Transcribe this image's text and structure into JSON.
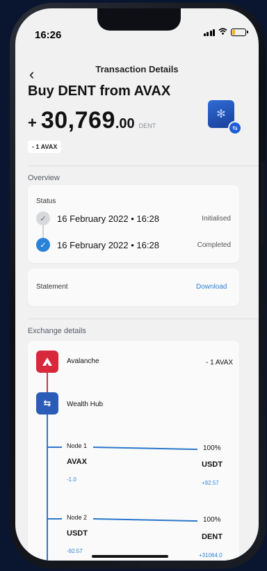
{
  "status_bar": {
    "time": "16:26"
  },
  "nav": {
    "back": "‹",
    "title": "Transaction Details"
  },
  "header": {
    "title": "Buy DENT from AVAX",
    "amount_sign": "+",
    "amount_integer": "30,769",
    "amount_decimal": ".00",
    "amount_currency": "DENT",
    "spent_pill": "- 1 AVAX"
  },
  "overview": {
    "section_label": "Overview",
    "status_label": "Status",
    "rows": [
      {
        "date": "16 February 2022 • 16:28",
        "state": "Initialised"
      },
      {
        "date": "16 February 2022 • 16:28",
        "state": "Completed"
      }
    ]
  },
  "statement": {
    "label": "Statement",
    "action": "Download"
  },
  "exchange": {
    "section_label": "Exchange details",
    "source": {
      "name": "Avalanche",
      "amount": "- 1 AVAX"
    },
    "hub": {
      "name": "Wealth Hub"
    },
    "nodes": [
      {
        "label": "Node 1",
        "percent": "100%",
        "from": "AVAX",
        "to": "USDT",
        "from_delta": "-1.0",
        "to_delta": "+92.57"
      },
      {
        "label": "Node 2",
        "percent": "100%",
        "from": "USDT",
        "to": "DENT",
        "from_delta": "-92.57",
        "to_delta": "+31064.0"
      }
    ]
  },
  "colors": {
    "accent": "#2a82d7",
    "avalanche_red": "#d8283c",
    "hub_blue": "#2b5db8",
    "tree_line": "#2a77cc"
  },
  "icons": {
    "status_pending": "check-icon",
    "status_done": "check-icon",
    "avalanche": "avalanche-logo-icon",
    "hub": "swap-icon",
    "token": "dent-token-icon"
  }
}
